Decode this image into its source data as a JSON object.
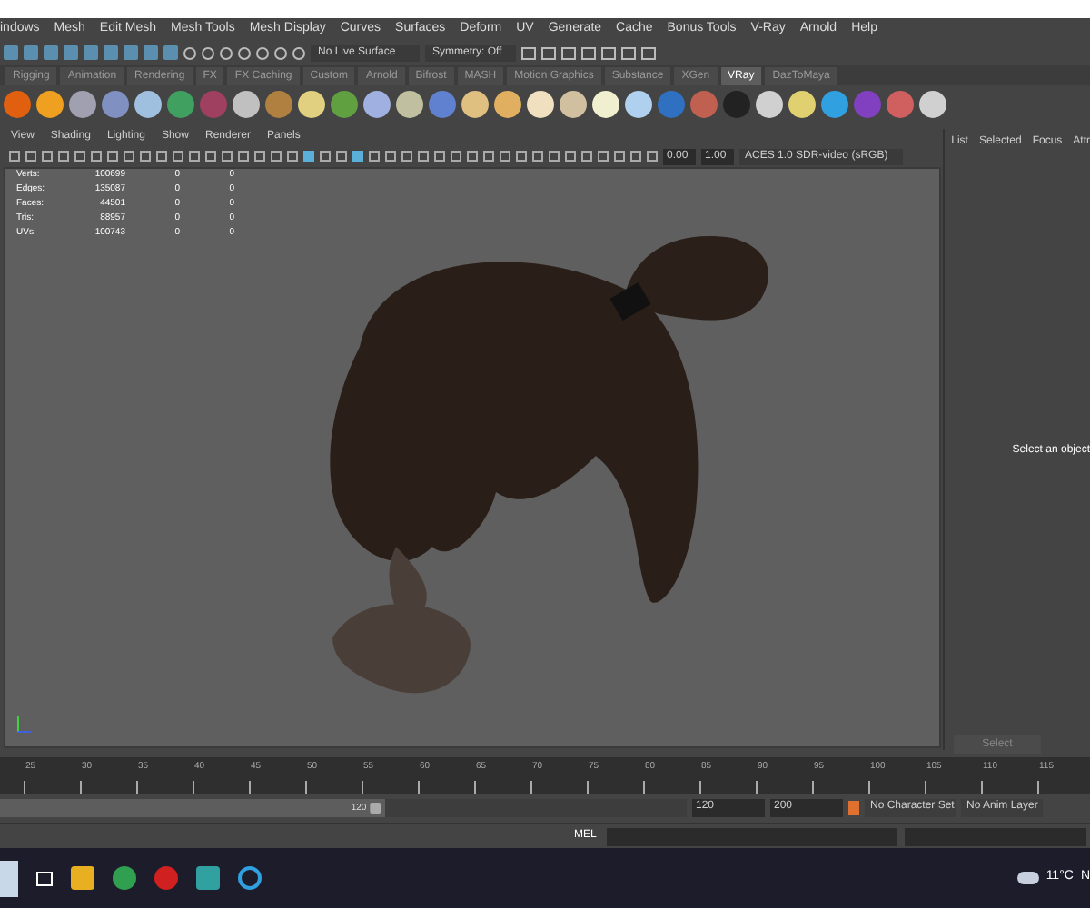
{
  "main_menu": [
    "indows",
    "Mesh",
    "Edit Mesh",
    "Mesh Tools",
    "Mesh Display",
    "Curves",
    "Surfaces",
    "Deform",
    "UV",
    "Generate",
    "Cache",
    "Bonus Tools",
    "V-Ray",
    "Arnold",
    "Help"
  ],
  "status_line": {
    "live_surface": "No Live Surface",
    "symmetry": "Symmetry: Off"
  },
  "shelf_tabs": [
    {
      "label": "Rigging",
      "selected": false
    },
    {
      "label": "Animation",
      "selected": false
    },
    {
      "label": "Rendering",
      "selected": false
    },
    {
      "label": "FX",
      "selected": false
    },
    {
      "label": "FX Caching",
      "selected": false
    },
    {
      "label": "Custom",
      "selected": false
    },
    {
      "label": "Arnold",
      "selected": false
    },
    {
      "label": "Bifrost",
      "selected": false
    },
    {
      "label": "MASH",
      "selected": false
    },
    {
      "label": "Motion Graphics",
      "selected": false
    },
    {
      "label": "Substance",
      "selected": false
    },
    {
      "label": "XGen",
      "selected": false
    },
    {
      "label": "VRay",
      "selected": true
    },
    {
      "label": "DazToMaya",
      "selected": false
    }
  ],
  "viewport": {
    "menu": [
      "View",
      "Shading",
      "Lighting",
      "Show",
      "Renderer",
      "Panels"
    ],
    "exposure": "0.00",
    "gamma": "1.00",
    "color_space": "ACES 1.0 SDR-video (sRGB)",
    "stats": [
      {
        "label": "Verts:",
        "values": [
          "100699",
          "0",
          "0"
        ]
      },
      {
        "label": "Edges:",
        "values": [
          "135087",
          "0",
          "0"
        ]
      },
      {
        "label": "Faces:",
        "values": [
          "44501",
          "0",
          "0"
        ]
      },
      {
        "label": "Tris:",
        "values": [
          "88957",
          "0",
          "0"
        ]
      },
      {
        "label": "UVs:",
        "values": [
          "100743",
          "0",
          "0"
        ]
      }
    ]
  },
  "attribute_panel": {
    "tabs": [
      "List",
      "Selected",
      "Focus",
      "Attr"
    ],
    "message": "Select an object",
    "button": "Select"
  },
  "timeline": {
    "ticks": [
      "25",
      "30",
      "35",
      "40",
      "45",
      "50",
      "55",
      "60",
      "65",
      "70",
      "75",
      "80",
      "85",
      "90",
      "95",
      "100",
      "105",
      "110",
      "115"
    ]
  },
  "range": {
    "level": 0.56,
    "slider_value": "120",
    "end": "120",
    "max": "200",
    "character_set": "No Character Set",
    "anim_layer": "No Anim Layer"
  },
  "command_line": {
    "label": "MEL"
  },
  "taskbar": {
    "temperature": "11°C",
    "weather_text": "N"
  }
}
